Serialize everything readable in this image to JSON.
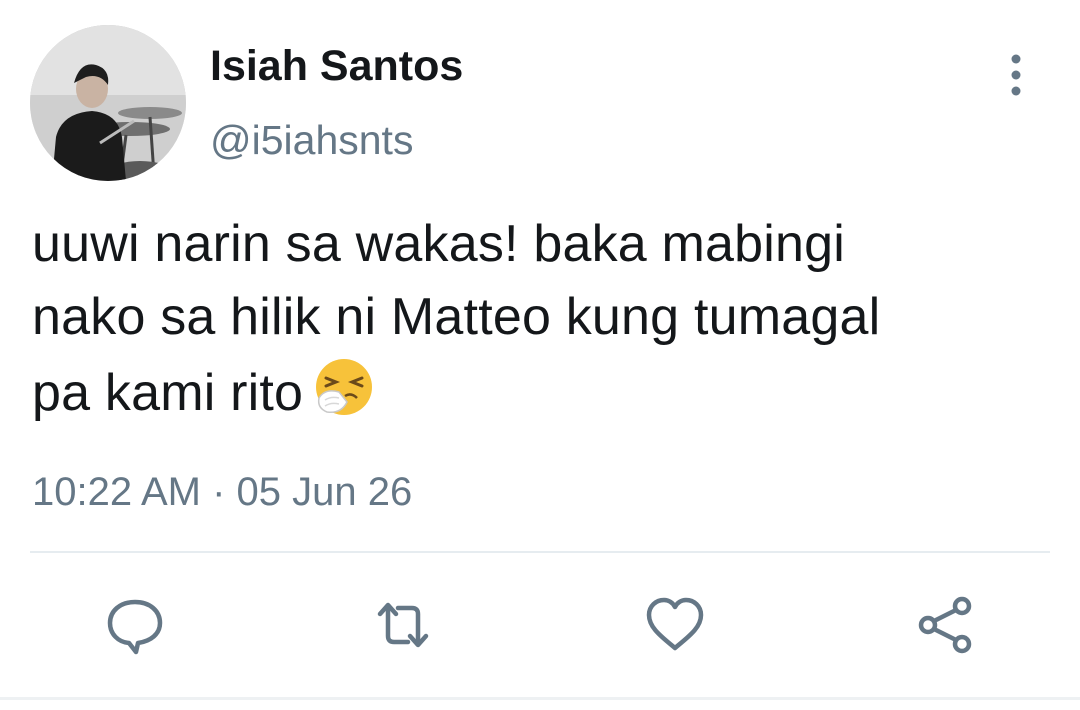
{
  "author": {
    "display_name": "Isiah Santos",
    "handle": "@i5iahsnts",
    "avatar_icon": "profile-photo"
  },
  "tweet": {
    "lines": [
      "uuwi narin sa wakas! baka mabingi",
      "nako sa hilik ni Matteo kung tumagal",
      "pa kami rito"
    ],
    "emoji": "sneezing-face"
  },
  "meta": {
    "timestamp": "10:22 AM · 05 Jun 26"
  },
  "actions": {
    "items": [
      "reply-icon",
      "retweet-icon",
      "like-icon",
      "share-icon"
    ]
  },
  "colors": {
    "text": "#14171a",
    "secondary": "#657786",
    "icon": "#657786",
    "divider": "#e6ecf0"
  }
}
